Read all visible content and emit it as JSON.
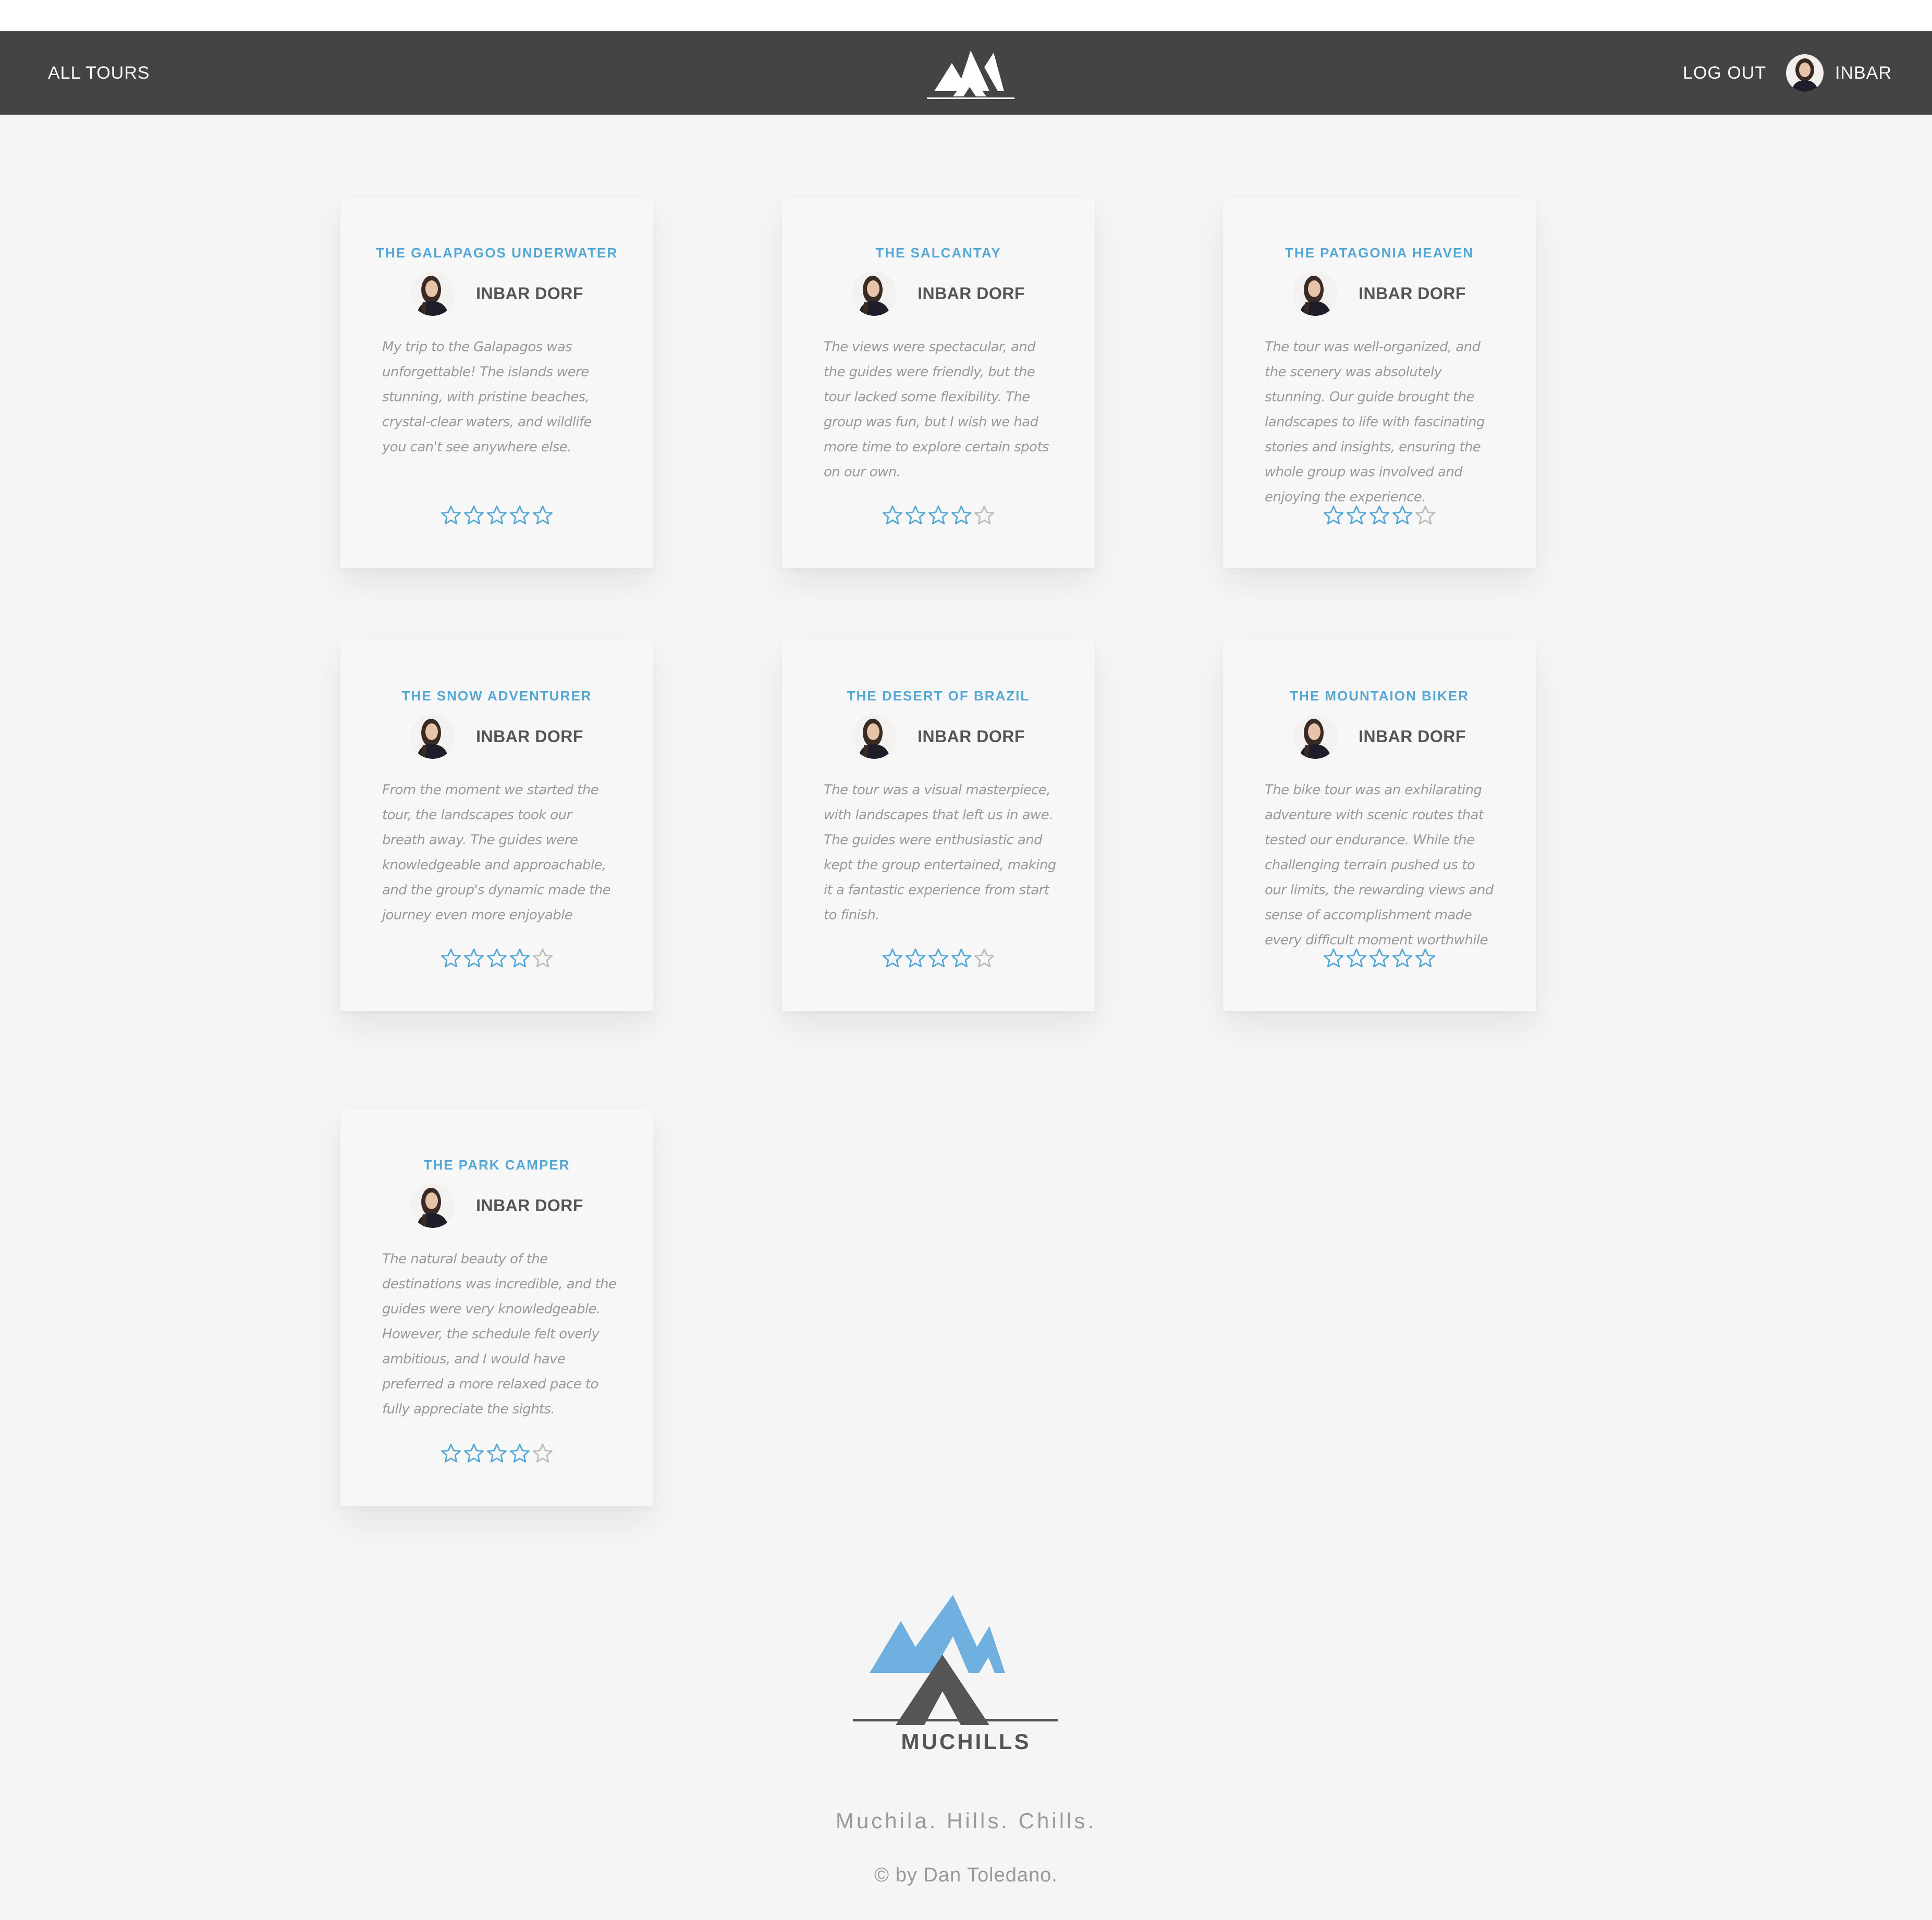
{
  "nav": {
    "all_tours": "ALL TOURS",
    "logout": "LOG OUT",
    "user_name": "INBAR"
  },
  "reviews": [
    {
      "tour": "THE GALAPAGOS UNDERWATER",
      "reviewer": "INBAR DORF",
      "text": "My trip to the Galapagos was unforgettable! The islands were stunning, with pristine beaches, crystal-clear waters, and wildlife you can't see anywhere else.",
      "rating": 5
    },
    {
      "tour": "THE SALCANTAY",
      "reviewer": "INBAR DORF",
      "text": "The views were spectacular, and the guides were friendly, but the tour lacked some flexibility. The group was fun, but I wish we had more time to explore certain spots on our own.",
      "rating": 4
    },
    {
      "tour": "THE PATAGONIA HEAVEN",
      "reviewer": "INBAR DORF",
      "text": "The tour was well-organized, and the scenery was absolutely stunning. Our guide brought the landscapes to life with fascinating stories and insights, ensuring the whole group was involved and enjoying the experience.",
      "rating": 4
    },
    {
      "tour": "THE SNOW ADVENTURER",
      "reviewer": "INBAR DORF",
      "text": "From the moment we started the tour, the landscapes took our breath away. The guides were knowledgeable and approachable, and the group's dynamic made the journey even more enjoyable",
      "rating": 4
    },
    {
      "tour": "THE DESERT OF BRAZIL",
      "reviewer": "INBAR DORF",
      "text": "The tour was a visual masterpiece, with landscapes that left us in awe. The guides were enthusiastic and kept the group entertained, making it a fantastic experience from start to finish.",
      "rating": 4
    },
    {
      "tour": "THE MOUNTAION BIKER",
      "reviewer": "INBAR DORF",
      "text": "The bike tour was an exhilarating adventure with scenic routes that tested our endurance. While the challenging terrain pushed us to our limits, the rewarding views and sense of accomplishment made every difficult moment worthwhile",
      "rating": 5
    },
    {
      "tour": "THE PARK CAMPER",
      "reviewer": "INBAR DORF",
      "text": "The natural beauty of the destinations was incredible, and the guides were very knowledgeable. However, the schedule felt overly ambitious, and I would have preferred a more relaxed pace to fully appreciate the sights.",
      "rating": 4
    }
  ],
  "footer": {
    "brand": "MUCHILLS",
    "tagline": "Muchila. Hills. Chills.",
    "copyright": "© by Dan Toledano."
  },
  "colors": {
    "accent": "#55a7d6",
    "navbar": "#444444",
    "background": "#f5f5f5",
    "star_empty": "#bbbbbb"
  },
  "icons": [
    "mountain-logo-icon",
    "user-avatar",
    "star-icon"
  ]
}
